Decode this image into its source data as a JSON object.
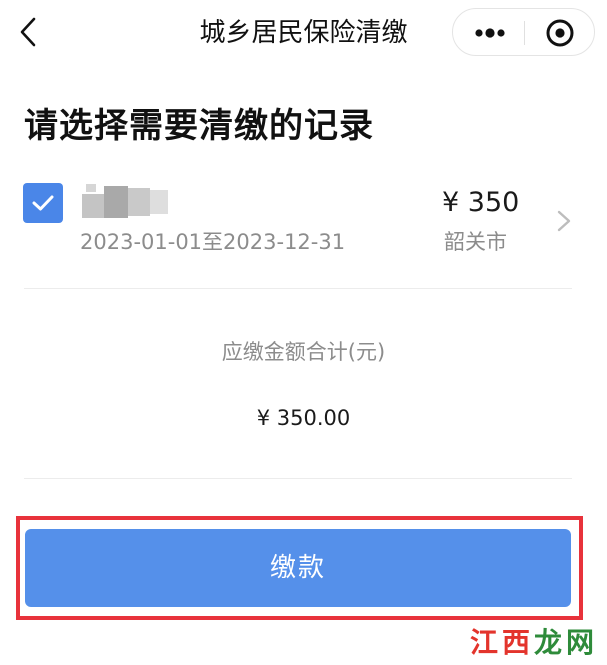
{
  "nav": {
    "title": "城乡居民保险清缴",
    "back_icon": "chevron-left-icon",
    "more_icon": "more-dots-icon",
    "close_icon": "target-close-icon"
  },
  "heading": "请选择需要清缴的记录",
  "record": {
    "checked": true,
    "date_range": "2023-01-01至2023-12-31",
    "amount": "¥ 350",
    "city": "韶关市"
  },
  "total": {
    "label": "应缴金额合计(元)",
    "value": "¥ 350.00"
  },
  "pay_button": {
    "label": "缴款"
  },
  "watermark": {
    "text": "江西龙网"
  },
  "colors": {
    "accent": "#5590ea",
    "checkbox": "#4a86e8",
    "highlight": "#e8323b"
  }
}
